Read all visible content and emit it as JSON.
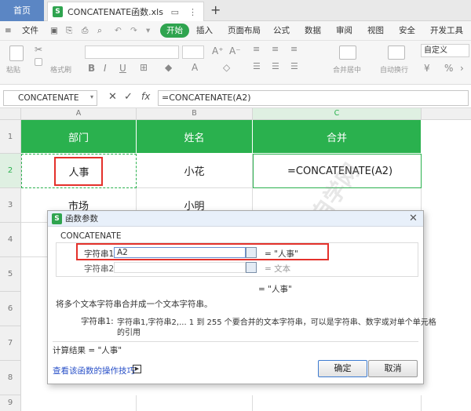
{
  "titlebar": {
    "home_tab": "首页",
    "doc_tab": "CONCATENATE函数.xls",
    "doc_icon": "S",
    "add_tab": "+"
  },
  "menubar": {
    "file": "文件",
    "items": [
      "开始",
      "插入",
      "页面布局",
      "公式",
      "数据",
      "审阅",
      "视图",
      "安全",
      "开发工具"
    ]
  },
  "ribbon": {
    "cut_label": "剪切",
    "paste_label": "粘贴",
    "format_painter_label": "格式刷",
    "merge_label": "合并居中",
    "wrap_label": "自动换行",
    "number_format": "自定义",
    "bold": "B",
    "italic": "I",
    "underline": "U",
    "percent": "%"
  },
  "formula_bar": {
    "name_box": "CONCATENATE",
    "cancel": "✕",
    "confirm": "✓",
    "fx": "fx",
    "formula": "=CONCATENATE(A2)"
  },
  "grid": {
    "columns": [
      "A",
      "B",
      "C"
    ],
    "rows": [
      "1",
      "2",
      "3",
      "4",
      "5",
      "6",
      "7",
      "8",
      "9"
    ],
    "header_row": [
      "部门",
      "姓名",
      "合并"
    ],
    "row2": [
      "人事",
      "小花",
      "=CONCATENATE(A2)"
    ],
    "row3": [
      "市场",
      "小明",
      ""
    ]
  },
  "dialog": {
    "title": "函数参数",
    "function_name": "CONCATENATE",
    "arg1_label": "字符串1",
    "arg1_value": "A2",
    "arg1_result": "= \"人事\"",
    "arg2_label": "字符串2",
    "arg2_result": "= 文本",
    "total_result": "= \"人事\"",
    "description": "将多个文本字符串合并成一个文本字符串。",
    "param_label": "字符串1:",
    "param_desc_line1": "字符串1,字符串2,... 1 到 255 个要合并的文本字符串，可以是字符串、数字或对单个单元格",
    "param_desc_line2": "的引用",
    "calc_result": "计算结果 = \"人事\"",
    "help_link": "查看该函数的操作技巧",
    "ok": "确定",
    "cancel": "取消"
  },
  "colors": {
    "accent_green": "#2ab14e",
    "highlight_red": "#e4312b",
    "home_tab_blue": "#5b86c4"
  }
}
